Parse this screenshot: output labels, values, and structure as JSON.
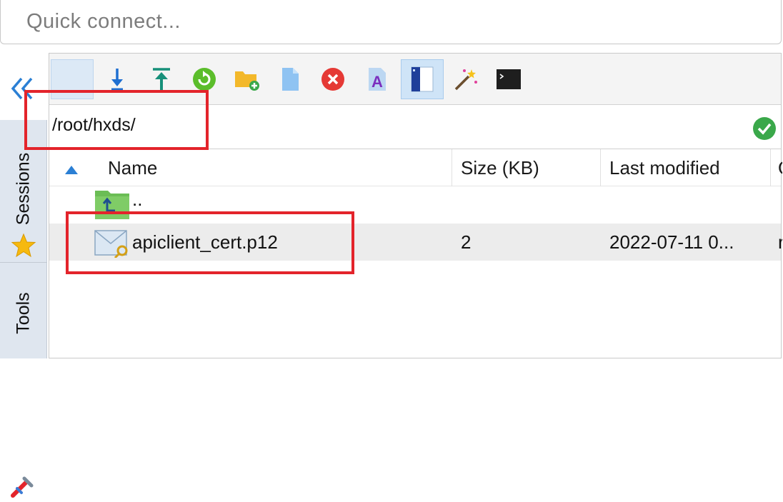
{
  "quick_connect": {
    "placeholder": "Quick connect..."
  },
  "sidebar": {
    "collapse_icon": "double-chevron-left-icon",
    "tabs": [
      {
        "label": "Sessions",
        "icon": "star-icon"
      },
      {
        "label": "Tools",
        "icon": "tools-icon"
      }
    ]
  },
  "toolbar": {
    "buttons": [
      {
        "name": "blank",
        "icon": "none"
      },
      {
        "name": "download",
        "icon": "download-arrow-icon"
      },
      {
        "name": "upload",
        "icon": "upload-arrow-icon"
      },
      {
        "name": "refresh",
        "icon": "refresh-icon"
      },
      {
        "name": "new-folder",
        "icon": "new-folder-icon"
      },
      {
        "name": "new-file",
        "icon": "new-file-icon"
      },
      {
        "name": "delete",
        "icon": "delete-icon"
      },
      {
        "name": "rename",
        "icon": "rename-icon"
      },
      {
        "name": "toggle-panel",
        "icon": "panel-toggle-icon",
        "active": true
      },
      {
        "name": "magic",
        "icon": "magic-wand-icon"
      },
      {
        "name": "terminal",
        "icon": "terminal-icon"
      }
    ]
  },
  "path": {
    "value": "/root/hxds/",
    "status_icon": "check-icon"
  },
  "table": {
    "sort_icon": "sort-ascending-icon",
    "columns": [
      "Name",
      "Size (KB)",
      "Last modified",
      "O"
    ],
    "rows": [
      {
        "name": "..",
        "size": "",
        "modified": "",
        "more": "",
        "icon": "parent-folder-icon"
      },
      {
        "name": "apiclient_cert.p12",
        "size": "2",
        "modified": "2022-07-11 0...",
        "more": "r",
        "icon": "certificate-file-icon"
      }
    ]
  },
  "colors": {
    "highlight": "#e3242b",
    "accent": "#2b7fd4",
    "selected_row": "#ececec"
  }
}
